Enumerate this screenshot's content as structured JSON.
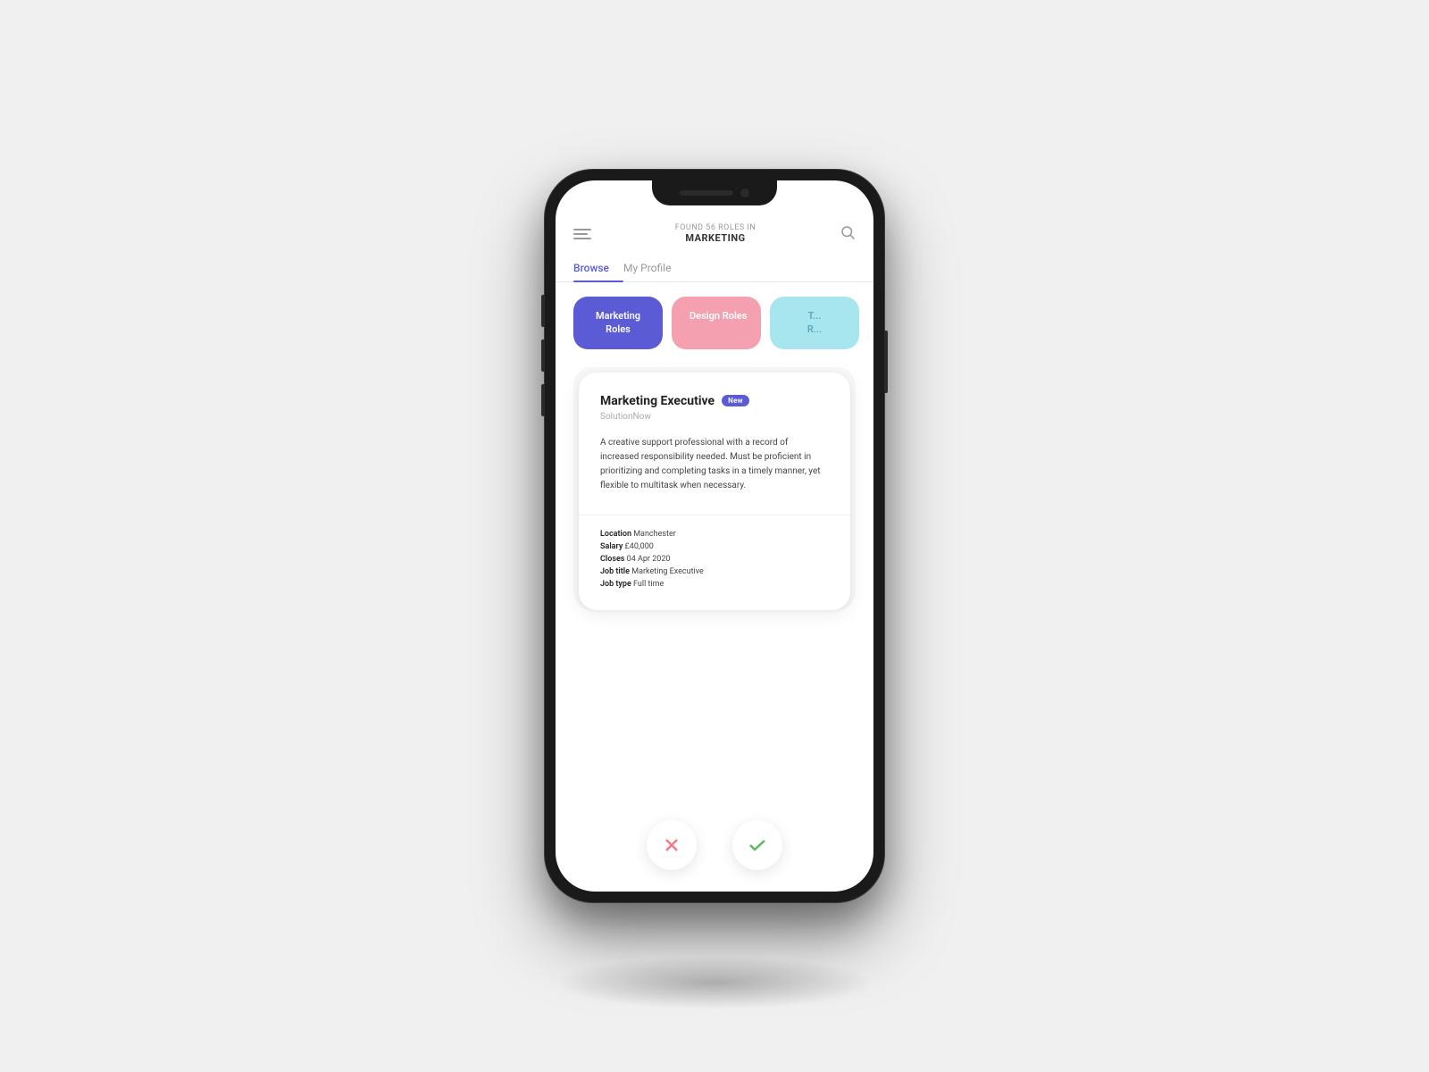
{
  "phone": {
    "notch": {
      "has_camera": true,
      "has_speaker": true
    }
  },
  "header": {
    "found_label": "FOUND 56 ROLES IN",
    "category": "MARKETING",
    "menu_icon": "menu-icon",
    "search_icon": "search-icon"
  },
  "tabs": [
    {
      "id": "browse",
      "label": "Browse",
      "active": true
    },
    {
      "id": "my-profile",
      "label": "My Profile",
      "active": false
    }
  ],
  "category_pills": [
    {
      "id": "marketing",
      "label": "Marketing\nRoles",
      "style": "marketing"
    },
    {
      "id": "design",
      "label": "Design Roles",
      "style": "design"
    },
    {
      "id": "tech",
      "label": "Tech\nRoles",
      "style": "tech"
    }
  ],
  "job_card": {
    "title": "Marketing Executive",
    "badge": "New",
    "company": "SolutionNow",
    "description": "A creative support professional with a record of increased responsibility needed. Must be proficient in prioritizing and completing tasks in a timely manner, yet flexible to multitask when necessary.",
    "details": {
      "location_label": "Location",
      "location_value": "Manchester",
      "salary_label": "Salary",
      "salary_value": "£40,000",
      "closes_label": "Closes",
      "closes_value": "04 Apr 2020",
      "job_title_label": "Job title",
      "job_title_value": "Marketing Executive",
      "job_type_label": "Job type",
      "job_type_value": "Full time"
    }
  },
  "actions": {
    "reject_label": "Reject",
    "accept_label": "Accept"
  }
}
